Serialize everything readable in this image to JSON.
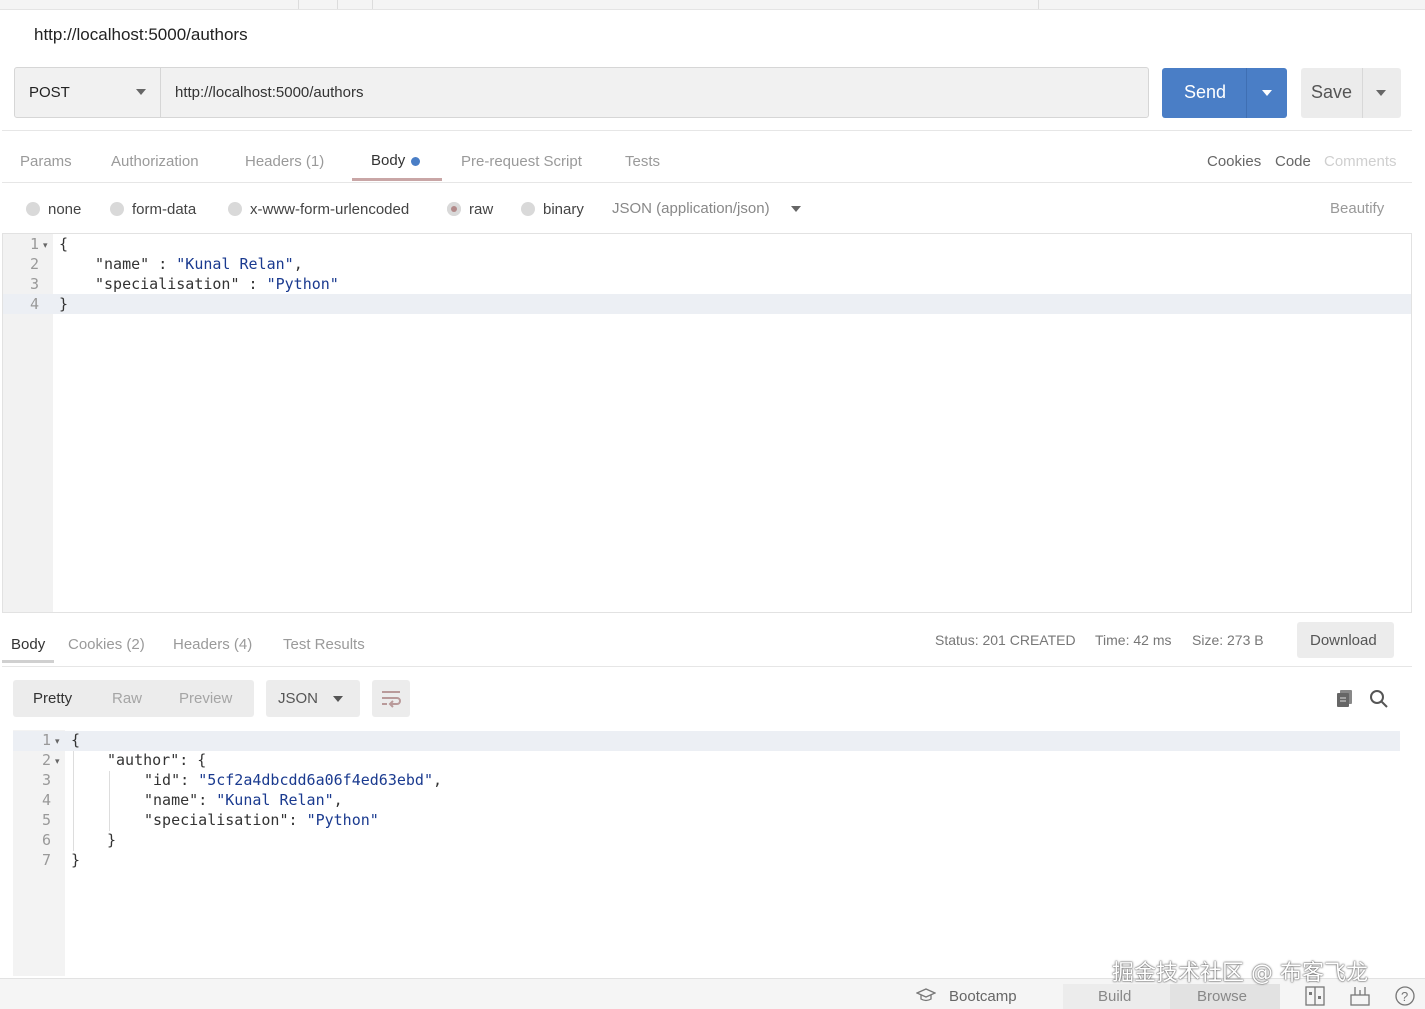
{
  "window": {
    "title": "http://localhost:5000/authors"
  },
  "request": {
    "method": "POST",
    "url": "http://localhost:5000/authors",
    "send_label": "Send",
    "save_label": "Save"
  },
  "request_tabs": {
    "params": "Params",
    "authorization": "Authorization",
    "headers": "Headers (1)",
    "body": "Body",
    "prerequest": "Pre-request Script",
    "tests": "Tests",
    "cookies": "Cookies",
    "code": "Code",
    "comments": "Comments"
  },
  "body_types": {
    "none": "none",
    "form_data": "form-data",
    "urlencoded": "x-www-form-urlencoded",
    "raw": "raw",
    "binary": "binary",
    "content_type": "JSON (application/json)",
    "beautify": "Beautify",
    "selected": "raw"
  },
  "request_body": {
    "line_numbers": [
      "1",
      "2",
      "3",
      "4"
    ],
    "l1": "{",
    "l2_key": "\"name\"",
    "l2_sep": " : ",
    "l2_val": "\"Kunal Relan\"",
    "l2_end": ",",
    "l3_key": "\"specialisation\"",
    "l3_sep": " : ",
    "l3_val": "\"Python\"",
    "l4": "}"
  },
  "response_tabs": {
    "body": "Body",
    "cookies": "Cookies (2)",
    "headers": "Headers (4)",
    "test_results": "Test Results"
  },
  "response_meta": {
    "status": "Status: 201 CREATED",
    "time": "Time: 42 ms",
    "size": "Size: 273 B",
    "download": "Download"
  },
  "response_view": {
    "pretty": "Pretty",
    "raw": "Raw",
    "preview": "Preview",
    "format": "JSON"
  },
  "response_body": {
    "line_numbers": [
      "1",
      "2",
      "3",
      "4",
      "5",
      "6",
      "7"
    ],
    "l1": "{",
    "l2_key": "\"author\"",
    "l2_rest": ": {",
    "l3_key": "\"id\"",
    "l3_val": "\"5cf2a4dbcdd6a06f4ed63ebd\"",
    "l4_key": "\"name\"",
    "l4_val": "\"Kunal Relan\"",
    "l5_key": "\"specialisation\"",
    "l5_val": "\"Python\"",
    "l6": "}",
    "l7": "}"
  },
  "statusbar": {
    "bootcamp": "Bootcamp",
    "build": "Build",
    "browse": "Browse"
  },
  "watermark": "掘金技术社区 @ 布客飞龙",
  "colors": {
    "accent": "#4a7ec6",
    "string": "#1a3a8f"
  }
}
